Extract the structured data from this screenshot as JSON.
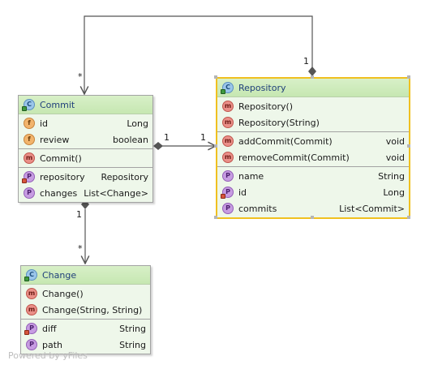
{
  "classes": {
    "commit": {
      "name": "Commit",
      "fields": [
        {
          "name": "id",
          "type": "Long"
        },
        {
          "name": "review",
          "type": "boolean"
        }
      ],
      "methods": [
        {
          "name": "Commit()",
          "type": ""
        }
      ],
      "properties": [
        {
          "name": "repository",
          "type": "Repository"
        },
        {
          "name": "changes",
          "type": "List<Change>"
        }
      ]
    },
    "repository": {
      "name": "Repository",
      "constructors": [
        {
          "name": "Repository()",
          "type": ""
        },
        {
          "name": "Repository(String)",
          "type": ""
        }
      ],
      "methods": [
        {
          "name": "addCommit(Commit)",
          "type": "void"
        },
        {
          "name": "removeCommit(Commit)",
          "type": "void"
        }
      ],
      "properties": [
        {
          "name": "name",
          "type": "String"
        },
        {
          "name": "id",
          "type": "Long"
        },
        {
          "name": "commits",
          "type": "List<Commit>"
        }
      ]
    },
    "change": {
      "name": "Change",
      "constructors": [
        {
          "name": "Change()",
          "type": ""
        },
        {
          "name": "Change(String, String)",
          "type": ""
        }
      ],
      "properties": [
        {
          "name": "diff",
          "type": "String"
        },
        {
          "name": "path",
          "type": "String"
        }
      ]
    }
  },
  "badges": {
    "class": "C",
    "field": "f",
    "method": "m",
    "property": "P"
  },
  "multiplicities": {
    "repo_top": "1",
    "commit_top": "*",
    "commit_repo_source": "1",
    "commit_repo_target": "1",
    "commit_bottom": "1",
    "change_top": "*"
  },
  "watermark": "Powered by yFiles",
  "colors": {
    "selection": "#f0c020",
    "header_green": "#c6e7b2",
    "body_green": "#eef7ea",
    "edge": "#555555"
  }
}
